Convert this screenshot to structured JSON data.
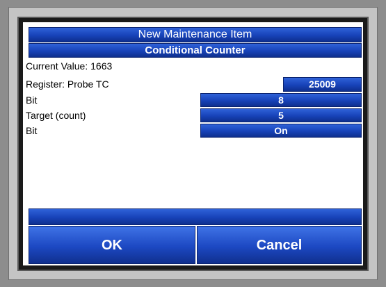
{
  "header": {
    "title": "New Maintenance Item",
    "subtitle": "Conditional Counter"
  },
  "fields": {
    "current_value_label": "Current Value: 1663",
    "register_label": "Register: Probe TC",
    "register_value": "25009",
    "bit_label": "Bit",
    "bit_value": "8",
    "target_label": "Target (count)",
    "target_value": "5",
    "bit2_label": "Bit",
    "bit2_value": "On"
  },
  "status": {
    "text": ""
  },
  "buttons": {
    "ok_label": "OK",
    "cancel_label": "Cancel"
  },
  "colors": {
    "accent_blue": "#1742b8",
    "screen_background": "#ffffff",
    "bezel": "#c4c4c4"
  }
}
